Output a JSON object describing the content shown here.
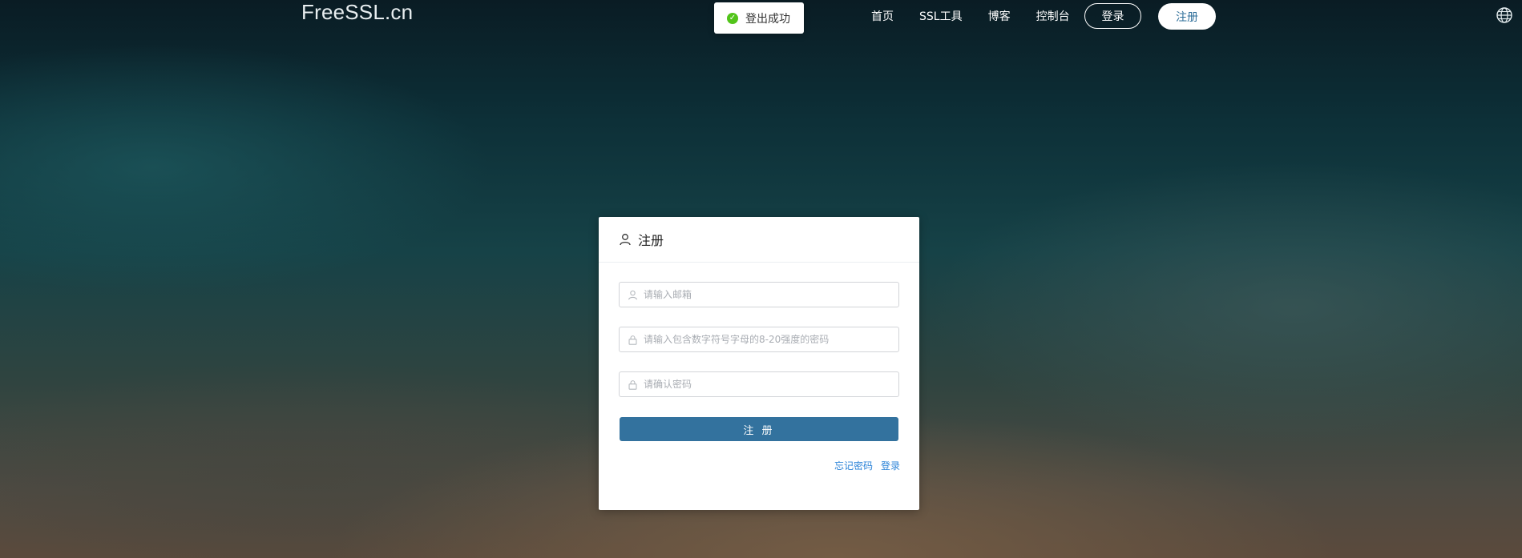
{
  "header": {
    "logo": "FreeSSL.cn",
    "nav": [
      "首页",
      "SSL工具",
      "博客",
      "控制台"
    ],
    "login_button": "登录",
    "register_button": "注册",
    "language_icon": "globe-icon"
  },
  "toast": {
    "message": "登出成功",
    "icon": "check-circle-icon",
    "color": "#52c41a"
  },
  "register_form": {
    "title": "注册",
    "title_icon": "user-icon",
    "email_placeholder": "请输入邮箱",
    "password_placeholder": "请输入包含数字符号字母的8-20强度的密码",
    "confirm_placeholder": "请确认密码",
    "submit_label": "注 册",
    "forgot_link": "忘记密码",
    "login_link": "登录",
    "accent_color": "#33729e"
  }
}
